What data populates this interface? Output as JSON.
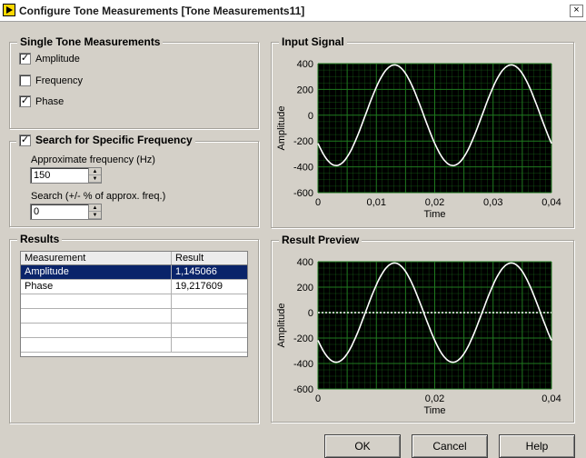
{
  "window": {
    "title": "Configure Tone Measurements [Tone Measurements11]",
    "close_glyph": "×"
  },
  "single_tone": {
    "title": "Single Tone Measurements",
    "items": [
      {
        "label": "Amplitude",
        "checked": true,
        "mark": "✓"
      },
      {
        "label": "Frequency",
        "checked": false,
        "mark": ""
      },
      {
        "label": "Phase",
        "checked": true,
        "mark": "✓"
      }
    ]
  },
  "search": {
    "title": "Search for Specific Frequency",
    "checked": true,
    "mark": "✓",
    "approx_label": "Approximate frequency (Hz)",
    "approx_value": "150",
    "range_label": "Search (+/- % of approx. freq.)",
    "range_value": "0"
  },
  "results": {
    "title": "Results",
    "columns": [
      "Measurement",
      "Result"
    ],
    "rows": [
      {
        "measurement": "Amplitude",
        "result": "1,145066"
      },
      {
        "measurement": "Phase",
        "result": "19,217609"
      }
    ],
    "empty_rows": 5
  },
  "input_signal": {
    "title": "Input Signal"
  },
  "result_preview": {
    "title": "Result Preview"
  },
  "buttons": {
    "ok": "OK",
    "cancel": "Cancel",
    "help": "Help"
  },
  "colors": {
    "plot_bg": "#000000",
    "grid": "#1f7a1f",
    "trace": "#ffffff",
    "selection": "#0a246a"
  },
  "chart_data": [
    {
      "type": "line",
      "xlabel": "Time",
      "ylabel": "Amplitude",
      "xlim": [
        0,
        0.04
      ],
      "ylim": [
        -600,
        400
      ],
      "x_ticks": [
        "0",
        "0,01",
        "0,02",
        "0,03",
        "0,04"
      ],
      "y_ticks": [
        "400",
        "200",
        "0",
        "-200",
        "-400",
        "-600"
      ],
      "series": [
        {
          "amplitude": 390,
          "frequency": 50,
          "phase_deg": -146
        }
      ],
      "grid": true
    },
    {
      "type": "line",
      "xlabel": "Time",
      "ylabel": "Amplitude",
      "xlim": [
        0,
        0.04
      ],
      "ylim": [
        -600,
        400
      ],
      "x_ticks": [
        "0",
        "0,02",
        "0,04"
      ],
      "y_ticks": [
        "400",
        "200",
        "0",
        "-200",
        "-400",
        "-600"
      ],
      "series": [
        {
          "amplitude": 390,
          "frequency": 50,
          "phase_deg": -146
        },
        {
          "constant": 0,
          "style": "dotted"
        }
      ],
      "grid": true
    }
  ]
}
